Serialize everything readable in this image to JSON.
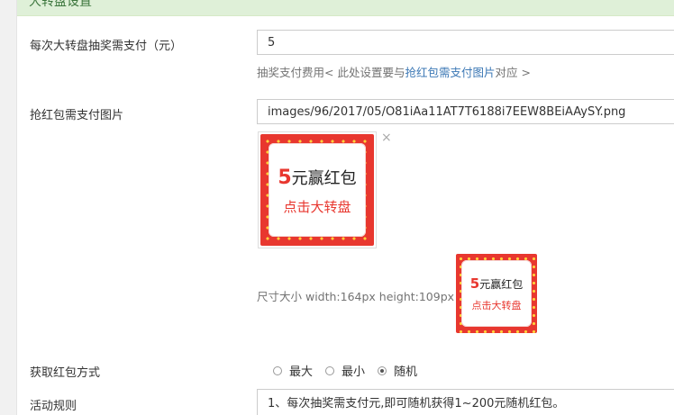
{
  "section": {
    "title": "大转盘设置"
  },
  "fields": {
    "pay_amount": {
      "label": "每次大转盘抽奖需支付（元）",
      "value": "5",
      "help_prefix": "抽奖支付费用< 此处设置要与",
      "help_link": "抢红包需支付图片",
      "help_suffix": "对应 >"
    },
    "pay_image": {
      "label": "抢红包需支付图片",
      "value": "images/96/2017/05/O81iAa11AT7T6188i7EEW8BEiAAySY.png",
      "size_hint": "尺寸大小 width:164px height:109px",
      "banner_number": "5",
      "banner_title": "元赢红包",
      "banner_sub": "点击大转盘",
      "remove_symbol": "×"
    },
    "method": {
      "label": "获取红包方式",
      "options": [
        "最大",
        "最小",
        "随机"
      ],
      "selected": "随机"
    },
    "rules": {
      "label": "活动规则",
      "line1": "1、每次抽奖需支付元,即可随机获得1~200元随机红包。"
    }
  },
  "colors": {
    "accent_red": "#e8372f",
    "link_blue": "#3c78b5",
    "success_bg": "#dff0d8"
  }
}
